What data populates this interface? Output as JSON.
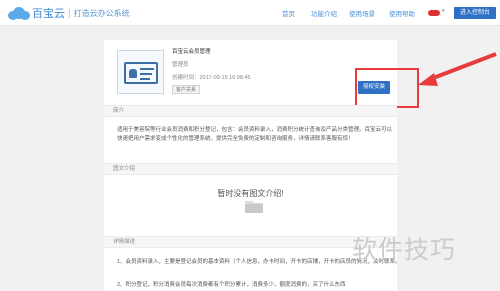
{
  "brand": {
    "name": "百宝云",
    "separator": "|",
    "slogan": "打造云办公系统"
  },
  "nav": {
    "items": [
      "首页",
      "功能介绍",
      "使用场景",
      "使用帮助"
    ],
    "user_caret": "▾",
    "console_label": "进入控制台"
  },
  "app": {
    "name": "百宝云会员管理",
    "role": "管理员",
    "created_time": "创建时间：2017-09-15 16:08:45",
    "tag": "客户关系",
    "auth_button": "授权安装"
  },
  "sections": {
    "intro_title": "简介",
    "intro_text": "适用于美容院等行业会员消费和积分登记，包含：会员资料录入，消费积分统计查询及产品分类管理。百宝云可以快速把用户需求变成个性化的管理系统，提供完全免费的定制和咨询服务，详情请联系客服有惊！",
    "graphic_title": "图文介绍",
    "graphic_empty": "暂时没有图文介绍!",
    "detail_title": "详情描述",
    "detail_1": "1、会员资料录入，主要是登记会员的基本资料（个人信息，办卡时间，开卡的店铺，开卡的店员的情况，及时联系。",
    "detail_2": "2、积分登记，积分消费会员每次消费都有个积分累计，消费多少，额度消费的，买了什么东西"
  },
  "watermark": "软件技巧",
  "colors": {
    "accent": "#2f6fc4",
    "highlight": "#e83b3b",
    "nav_text": "#4a90d9"
  }
}
